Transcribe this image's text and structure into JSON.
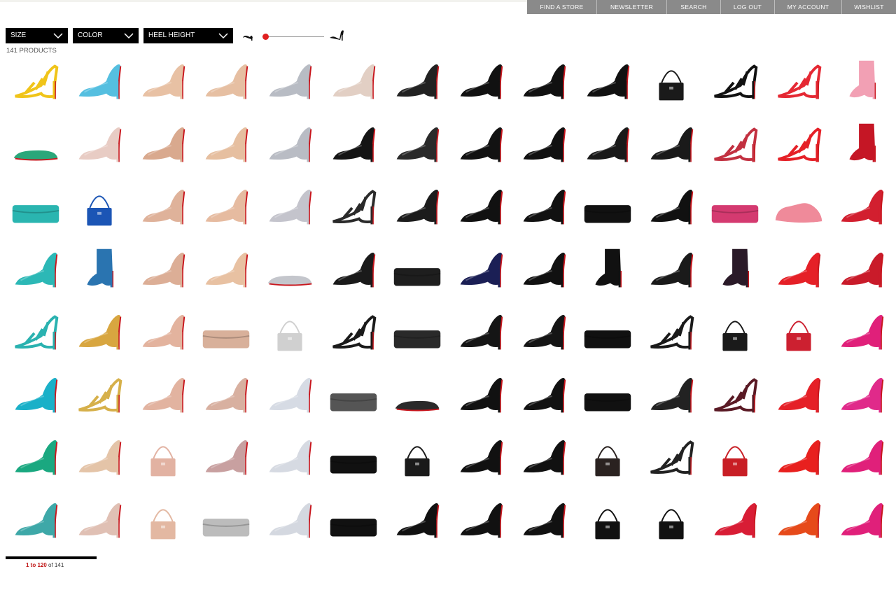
{
  "nav": {
    "items": [
      "FIND A STORE",
      "NEWSLETTER",
      "SEARCH",
      "LOG OUT",
      "MY ACCOUNT",
      "WISHLIST"
    ]
  },
  "filters": {
    "size": "SIZE",
    "color": "COLOR",
    "heel_height": "HEEL HEIGHT"
  },
  "heel_slider": {
    "value_fraction": 0.0
  },
  "product_count": "141 PRODUCTS",
  "pagination": {
    "range": "1 to 120",
    "of_label": "of 141"
  },
  "colors": {
    "nav_bg": "#8a8a8a",
    "filter_bg": "#000000",
    "accent_red": "#d42020",
    "sole_red": "#c8161d"
  },
  "products": [
    {
      "type": "sandal",
      "color": "#f0c419"
    },
    {
      "type": "pump",
      "color": "#55bfe0"
    },
    {
      "type": "pump",
      "color": "#e8c1a4"
    },
    {
      "type": "pump",
      "color": "#e6bfa2"
    },
    {
      "type": "pump",
      "color": "#b8bcc4"
    },
    {
      "type": "pump",
      "color": "#e2cfc4"
    },
    {
      "type": "pump",
      "color": "#222222"
    },
    {
      "type": "pump",
      "color": "#111111"
    },
    {
      "type": "pump",
      "color": "#111111"
    },
    {
      "type": "pump",
      "color": "#111111"
    },
    {
      "type": "bag",
      "color": "#1a1a1a"
    },
    {
      "type": "sandal",
      "color": "#111111"
    },
    {
      "type": "sandal",
      "color": "#e52833"
    },
    {
      "type": "boot",
      "color": "#f2a0b4"
    },
    {
      "type": "flat",
      "color": "#2aa77a"
    },
    {
      "type": "pump",
      "color": "#e8ccc4"
    },
    {
      "type": "pump",
      "color": "#d9a98e"
    },
    {
      "type": "pump",
      "color": "#e6bfa0"
    },
    {
      "type": "pump",
      "color": "#b9bcc4"
    },
    {
      "type": "pump",
      "color": "#151515"
    },
    {
      "type": "pump",
      "color": "#2a2a2a"
    },
    {
      "type": "pump",
      "color": "#121212"
    },
    {
      "type": "pump",
      "color": "#111111"
    },
    {
      "type": "pump",
      "color": "#1a1a1a"
    },
    {
      "type": "pump",
      "color": "#1a1a1a"
    },
    {
      "type": "sandal",
      "color": "#c23040"
    },
    {
      "type": "sandal",
      "color": "#e52027"
    },
    {
      "type": "boot",
      "color": "#c51625"
    },
    {
      "type": "clutch",
      "color": "#2ab5b0"
    },
    {
      "type": "bag",
      "color": "#1b55b5"
    },
    {
      "type": "pump",
      "color": "#dfb29a"
    },
    {
      "type": "pump",
      "color": "#e6bba0"
    },
    {
      "type": "pump",
      "color": "#c4c4cc"
    },
    {
      "type": "sandal",
      "color": "#2a2a2a"
    },
    {
      "type": "pump",
      "color": "#1c1c1c"
    },
    {
      "type": "pump",
      "color": "#111111"
    },
    {
      "type": "pump",
      "color": "#111111"
    },
    {
      "type": "clutch",
      "color": "#111111"
    },
    {
      "type": "pump",
      "color": "#111111"
    },
    {
      "type": "clutch",
      "color": "#d43a70"
    },
    {
      "type": "sneaker",
      "color": "#ef8a9a"
    },
    {
      "type": "pump",
      "color": "#d21f2f"
    },
    {
      "type": "pump",
      "color": "#2cb8b6"
    },
    {
      "type": "boot",
      "color": "#2a74b0"
    },
    {
      "type": "pump",
      "color": "#dcae96"
    },
    {
      "type": "pump",
      "color": "#e8c1a2"
    },
    {
      "type": "flat",
      "color": "#c4c6cc"
    },
    {
      "type": "pump",
      "color": "#1a1a1a"
    },
    {
      "type": "clutch",
      "color": "#1e1e1e"
    },
    {
      "type": "pump",
      "color": "#1b1f55"
    },
    {
      "type": "pump",
      "color": "#111111"
    },
    {
      "type": "boot",
      "color": "#111111"
    },
    {
      "type": "pump",
      "color": "#1a1a1a"
    },
    {
      "type": "boot",
      "color": "#2a1a28"
    },
    {
      "type": "pump",
      "color": "#e52027"
    },
    {
      "type": "pump",
      "color": "#c91b2a"
    },
    {
      "type": "sandal",
      "color": "#2ab2b0"
    },
    {
      "type": "pump",
      "color": "#d8a640"
    },
    {
      "type": "pump",
      "color": "#e3b39e"
    },
    {
      "type": "clutch",
      "color": "#d8b09a"
    },
    {
      "type": "bag",
      "color": "#d0d0d0"
    },
    {
      "type": "sandal",
      "color": "#1a1a1a"
    },
    {
      "type": "clutch",
      "color": "#2a2a2a"
    },
    {
      "type": "pump",
      "color": "#151515"
    },
    {
      "type": "pump",
      "color": "#151515"
    },
    {
      "type": "clutch",
      "color": "#111111"
    },
    {
      "type": "sandal",
      "color": "#1a1a1a"
    },
    {
      "type": "bag",
      "color": "#1a1a1a"
    },
    {
      "type": "bag",
      "color": "#cc2030"
    },
    {
      "type": "pump",
      "color": "#e0207a"
    },
    {
      "type": "pump",
      "color": "#1ab0c8"
    },
    {
      "type": "sandal",
      "color": "#d6b04a"
    },
    {
      "type": "pump",
      "color": "#e2b3a0"
    },
    {
      "type": "pump",
      "color": "#d8b0a0"
    },
    {
      "type": "pump",
      "color": "#d6dbe4"
    },
    {
      "type": "clutch",
      "color": "#555555"
    },
    {
      "type": "flat",
      "color": "#2a2a2a"
    },
    {
      "type": "pump",
      "color": "#111111"
    },
    {
      "type": "pump",
      "color": "#111111"
    },
    {
      "type": "clutch",
      "color": "#111111"
    },
    {
      "type": "pump",
      "color": "#222222"
    },
    {
      "type": "sandal",
      "color": "#5a1a25"
    },
    {
      "type": "pump",
      "color": "#e52027"
    },
    {
      "type": "pump",
      "color": "#e02a8a"
    },
    {
      "type": "pump",
      "color": "#1aa880"
    },
    {
      "type": "pump",
      "color": "#e4c4a8"
    },
    {
      "type": "bag",
      "color": "#e2b2a2"
    },
    {
      "type": "pump",
      "color": "#c8a0a0"
    },
    {
      "type": "pump",
      "color": "#d6dae2"
    },
    {
      "type": "clutch",
      "color": "#111111"
    },
    {
      "type": "bag",
      "color": "#1a1a1a"
    },
    {
      "type": "pump",
      "color": "#111111"
    },
    {
      "type": "pump",
      "color": "#111111"
    },
    {
      "type": "bag",
      "color": "#2a2220"
    },
    {
      "type": "sandal",
      "color": "#222222"
    },
    {
      "type": "bag",
      "color": "#c81e25"
    },
    {
      "type": "pump",
      "color": "#e8201e"
    },
    {
      "type": "pump",
      "color": "#e0207a"
    },
    {
      "type": "pump",
      "color": "#3ea8a8"
    },
    {
      "type": "pump",
      "color": "#e0c0b4"
    },
    {
      "type": "bag",
      "color": "#e3b8a2"
    },
    {
      "type": "clutch",
      "color": "#bcbcbc"
    },
    {
      "type": "pump",
      "color": "#d4d8e0"
    },
    {
      "type": "clutch",
      "color": "#111111"
    },
    {
      "type": "pump",
      "color": "#111111"
    },
    {
      "type": "pump",
      "color": "#111111"
    },
    {
      "type": "pump",
      "color": "#111111"
    },
    {
      "type": "bag",
      "color": "#111111"
    },
    {
      "type": "bag",
      "color": "#111111"
    },
    {
      "type": "pump",
      "color": "#d81d35"
    },
    {
      "type": "pump",
      "color": "#e64a1a"
    },
    {
      "type": "pump",
      "color": "#e0207a"
    }
  ]
}
